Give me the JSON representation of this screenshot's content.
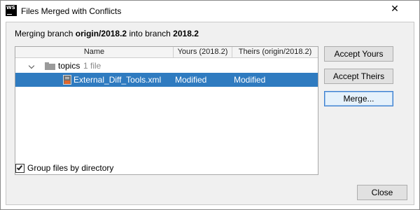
{
  "window": {
    "title": "Files Merged with Conflicts",
    "app_icon_text": "WS",
    "close_glyph": "✕"
  },
  "merge_info": {
    "prefix": "Merging branch",
    "source_branch": "origin/2018.2",
    "middle": "into branch",
    "target_branch": "2018.2"
  },
  "table": {
    "columns": [
      "Name",
      "Yours (2018.2)",
      "Theirs (origin/2018.2)"
    ],
    "folder": {
      "name": "topics",
      "count_text": "1 file",
      "icon": "folder-icon"
    },
    "files": [
      {
        "name": "External_Diff_Tools.xml",
        "yours": "Modified",
        "theirs": "Modified",
        "icon": "xml-file-icon",
        "selected": true
      }
    ]
  },
  "buttons": {
    "accept_yours": "Accept Yours",
    "accept_theirs": "Accept Theirs",
    "merge": "Merge...",
    "close": "Close"
  },
  "options": {
    "group_by_directory_label": "Group files by directory",
    "group_by_directory_checked": true
  },
  "colors": {
    "selection": "#2f7bc0",
    "focus_border": "#3b7fd0",
    "xml_tag": "#e0662c"
  }
}
